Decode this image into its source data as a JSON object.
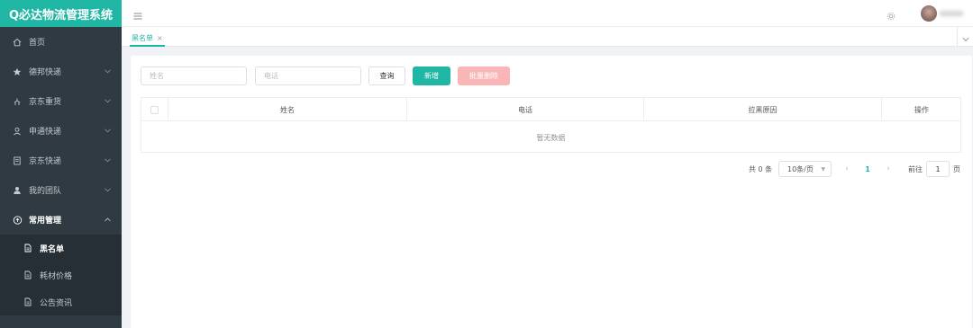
{
  "app": {
    "title": "Q必达物流管理系统"
  },
  "sidebar": {
    "items": [
      {
        "label": "首页",
        "icon": "home-icon"
      },
      {
        "label": "德邦快递",
        "icon": "star-icon"
      },
      {
        "label": "京东重货",
        "icon": "hanger-icon"
      },
      {
        "label": "申通快递",
        "icon": "user-icon"
      },
      {
        "label": "京东快递",
        "icon": "document-icon"
      },
      {
        "label": "我的团队",
        "icon": "team-icon"
      },
      {
        "label": "常用管理",
        "icon": "cloud-upload-icon"
      }
    ],
    "subitems": [
      {
        "label": "黑名单",
        "icon": "file-icon"
      },
      {
        "label": "耗材价格",
        "icon": "file-icon"
      },
      {
        "label": "公告资讯",
        "icon": "file-icon"
      }
    ]
  },
  "tabs": [
    {
      "label": "黑名单"
    }
  ],
  "search": {
    "name_placeholder": "姓名",
    "phone_placeholder": "电话",
    "query_label": "查询",
    "add_label": "新增",
    "batch_delete_label": "批量删除"
  },
  "table": {
    "columns": [
      "姓名",
      "电话",
      "拉黑原因",
      "操作"
    ],
    "empty_text": "暂无数据"
  },
  "pagination": {
    "total_text": "共 0 条",
    "page_size": "10条/页",
    "current_page": "1",
    "goto_label": "前往",
    "goto_value": "1",
    "page_unit": "页"
  },
  "colors": {
    "accent": "#1fb6a4",
    "sidebar_bg": "#2f3a42",
    "danger_light": "#fab6b6"
  }
}
